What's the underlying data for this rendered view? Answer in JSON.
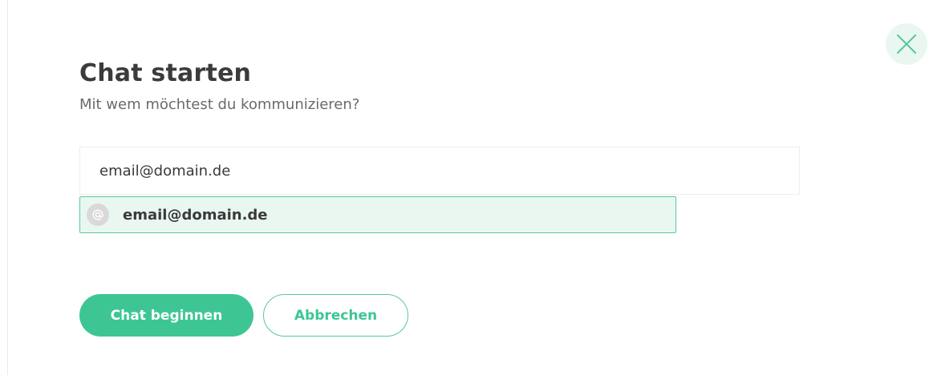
{
  "dialog": {
    "title": "Chat starten",
    "subtitle": "Mit wem möchtest du kommunizieren?",
    "close_icon": "close-icon"
  },
  "recipient": {
    "input_value": "email@domain.de",
    "suggestion": {
      "avatar_icon": "at-icon",
      "label": "email@domain.de"
    }
  },
  "actions": {
    "start_label": "Chat beginnen",
    "cancel_label": "Abbrechen"
  },
  "colors": {
    "accent": "#3dc693",
    "accent_light": "#eaf7f1",
    "text": "#3a3a3a"
  }
}
